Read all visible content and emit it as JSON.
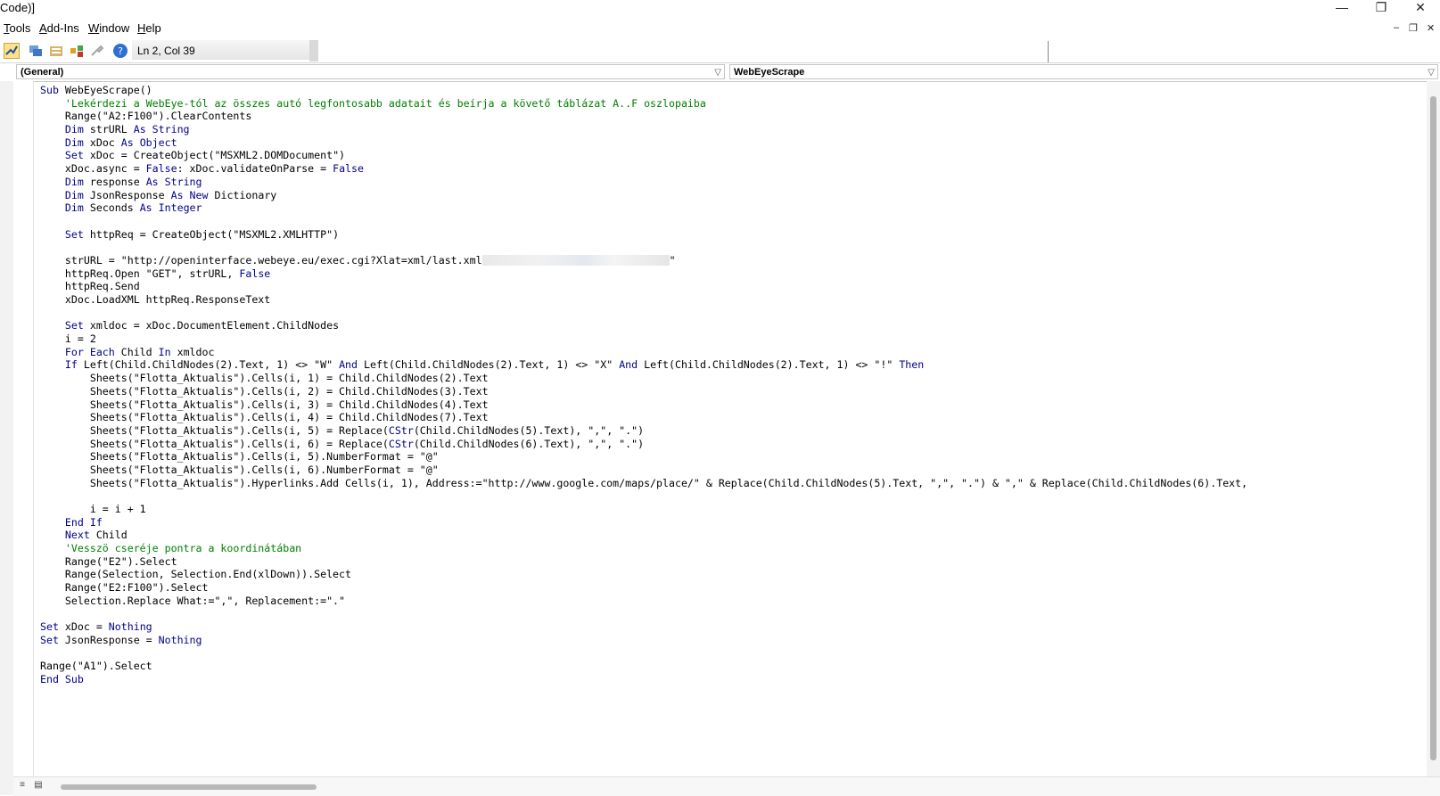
{
  "window": {
    "title": "Code)]",
    "controls": {
      "minimize": "—",
      "maximize": "❐",
      "close": "✕"
    }
  },
  "menu": {
    "items": [
      {
        "label": "ools",
        "accel": "T"
      },
      {
        "label": "dd-Ins",
        "accel": "A"
      },
      {
        "label": "indow",
        "accel": "W"
      },
      {
        "label": "elp",
        "accel": "H"
      }
    ],
    "mdi": {
      "minimize": "–",
      "restore": "❐",
      "close": "✕"
    }
  },
  "toolbar": {
    "icons": [
      "design-mode-icon",
      "project-explorer-icon",
      "properties-window-icon",
      "object-browser-icon",
      "toolbox-icon",
      "help-icon"
    ],
    "position": "Ln 2, Col 39"
  },
  "combos": {
    "object": "(General)",
    "procedure": "WebEyeScrape"
  },
  "code": [
    [
      [
        "k",
        "Sub"
      ],
      [
        "t",
        " WebEyeScrape()"
      ]
    ],
    [
      [
        "c",
        "    'Lekérdezi a WebEye-tól az összes autó legfontosabb adatait és beírja a követő táblázat A..F oszlopaiba"
      ]
    ],
    [
      [
        "t",
        "    Range(\"A2:F100\").ClearContents"
      ]
    ],
    [
      [
        "k",
        "    Dim"
      ],
      [
        "t",
        " strURL "
      ],
      [
        "k",
        "As String"
      ]
    ],
    [
      [
        "k",
        "    Dim"
      ],
      [
        "t",
        " xDoc "
      ],
      [
        "k",
        "As Object"
      ]
    ],
    [
      [
        "k",
        "    Set"
      ],
      [
        "t",
        " xDoc = CreateObject(\"MSXML2.DOMDocument\")"
      ]
    ],
    [
      [
        "t",
        "    xDoc.async = "
      ],
      [
        "k",
        "False"
      ],
      [
        "t",
        ": xDoc.validateOnParse = "
      ],
      [
        "k",
        "False"
      ]
    ],
    [
      [
        "k",
        "    Dim"
      ],
      [
        "t",
        " response "
      ],
      [
        "k",
        "As String"
      ]
    ],
    [
      [
        "k",
        "    Dim"
      ],
      [
        "t",
        " JsonResponse "
      ],
      [
        "k",
        "As New"
      ],
      [
        "t",
        " Dictionary"
      ]
    ],
    [
      [
        "k",
        "    Dim"
      ],
      [
        "t",
        " Seconds "
      ],
      [
        "k",
        "As Integer"
      ]
    ],
    [],
    [
      [
        "k",
        "    Set"
      ],
      [
        "t",
        " httpReq = CreateObject(\"MSXML2.XMLHTTP\")"
      ]
    ],
    [],
    [
      [
        "t",
        "    strURL = \"http://openinterface.webeye.eu/exec.cgi?Xlat=xml/last.xml"
      ],
      [
        "r",
        ""
      ],
      [
        "t",
        "\""
      ]
    ],
    [
      [
        "t",
        "    httpReq.Open \"GET\", strURL, "
      ],
      [
        "k",
        "False"
      ]
    ],
    [
      [
        "t",
        "    httpReq.Send"
      ]
    ],
    [
      [
        "t",
        "    xDoc.LoadXML httpReq.ResponseText"
      ]
    ],
    [],
    [
      [
        "k",
        "    Set"
      ],
      [
        "t",
        " xmldoc = xDoc.DocumentElement.ChildNodes"
      ]
    ],
    [
      [
        "t",
        "    i = 2"
      ]
    ],
    [
      [
        "k",
        "    For Each"
      ],
      [
        "t",
        " Child "
      ],
      [
        "k",
        "In"
      ],
      [
        "t",
        " xmldoc"
      ]
    ],
    [
      [
        "k",
        "    If"
      ],
      [
        "t",
        " Left(Child.ChildNodes(2).Text, 1) <> \"W\" "
      ],
      [
        "k",
        "And"
      ],
      [
        "t",
        " Left(Child.ChildNodes(2).Text, 1) <> \"X\" "
      ],
      [
        "k",
        "And"
      ],
      [
        "t",
        " Left(Child.ChildNodes(2).Text, 1) <> \"!\" "
      ],
      [
        "k",
        "Then"
      ]
    ],
    [
      [
        "t",
        "        Sheets(\"Flotta_Aktualis\").Cells(i, 1) = Child.ChildNodes(2).Text"
      ]
    ],
    [
      [
        "t",
        "        Sheets(\"Flotta_Aktualis\").Cells(i, 2) = Child.ChildNodes(3).Text"
      ]
    ],
    [
      [
        "t",
        "        Sheets(\"Flotta_Aktualis\").Cells(i, 3) = Child.ChildNodes(4).Text"
      ]
    ],
    [
      [
        "t",
        "        Sheets(\"Flotta_Aktualis\").Cells(i, 4) = Child.ChildNodes(7).Text"
      ]
    ],
    [
      [
        "t",
        "        Sheets(\"Flotta_Aktualis\").Cells(i, 5) = Replace("
      ],
      [
        "k",
        "CStr"
      ],
      [
        "t",
        "(Child.ChildNodes(5).Text), \",\", \".\")"
      ]
    ],
    [
      [
        "t",
        "        Sheets(\"Flotta_Aktualis\").Cells(i, 6) = Replace("
      ],
      [
        "k",
        "CStr"
      ],
      [
        "t",
        "(Child.ChildNodes(6).Text), \",\", \".\")"
      ]
    ],
    [
      [
        "t",
        "        Sheets(\"Flotta_Aktualis\").Cells(i, 5).NumberFormat = \"@\""
      ]
    ],
    [
      [
        "t",
        "        Sheets(\"Flotta_Aktualis\").Cells(i, 6).NumberFormat = \"@\""
      ]
    ],
    [
      [
        "t",
        "        Sheets(\"Flotta_Aktualis\").Hyperlinks.Add Cells(i, 1), Address:=\"http://www.google.com/maps/place/\" & Replace(Child.ChildNodes(5).Text, \",\", \".\") & \",\" & Replace(Child.ChildNodes(6).Text,"
      ]
    ],
    [],
    [
      [
        "t",
        "        i = i + 1"
      ]
    ],
    [
      [
        "k",
        "    End If"
      ]
    ],
    [
      [
        "k",
        "    Next"
      ],
      [
        "t",
        " Child"
      ]
    ],
    [
      [
        "c",
        "    'Vesszö cseréje pontra a koordinátában"
      ]
    ],
    [
      [
        "t",
        "    Range(\"E2\").Select"
      ]
    ],
    [
      [
        "t",
        "    Range(Selection, Selection.End(xlDown)).Select"
      ]
    ],
    [
      [
        "t",
        "    Range(\"E2:F100\").Select"
      ]
    ],
    [
      [
        "t",
        "    Selection.Replace What:=\",\", Replacement:=\".\""
      ]
    ],
    [],
    [
      [
        "k",
        "Set"
      ],
      [
        "t",
        " xDoc = "
      ],
      [
        "k",
        "Nothing"
      ]
    ],
    [
      [
        "k",
        "Set"
      ],
      [
        "t",
        " JsonResponse = "
      ],
      [
        "k",
        "Nothing"
      ]
    ],
    [],
    [
      [
        "t",
        "Range(\"A1\").Select"
      ]
    ],
    [
      [
        "k",
        "End Sub"
      ]
    ]
  ],
  "colors": {
    "keyword": "#00008b",
    "comment": "#008000",
    "text": "#000000"
  }
}
